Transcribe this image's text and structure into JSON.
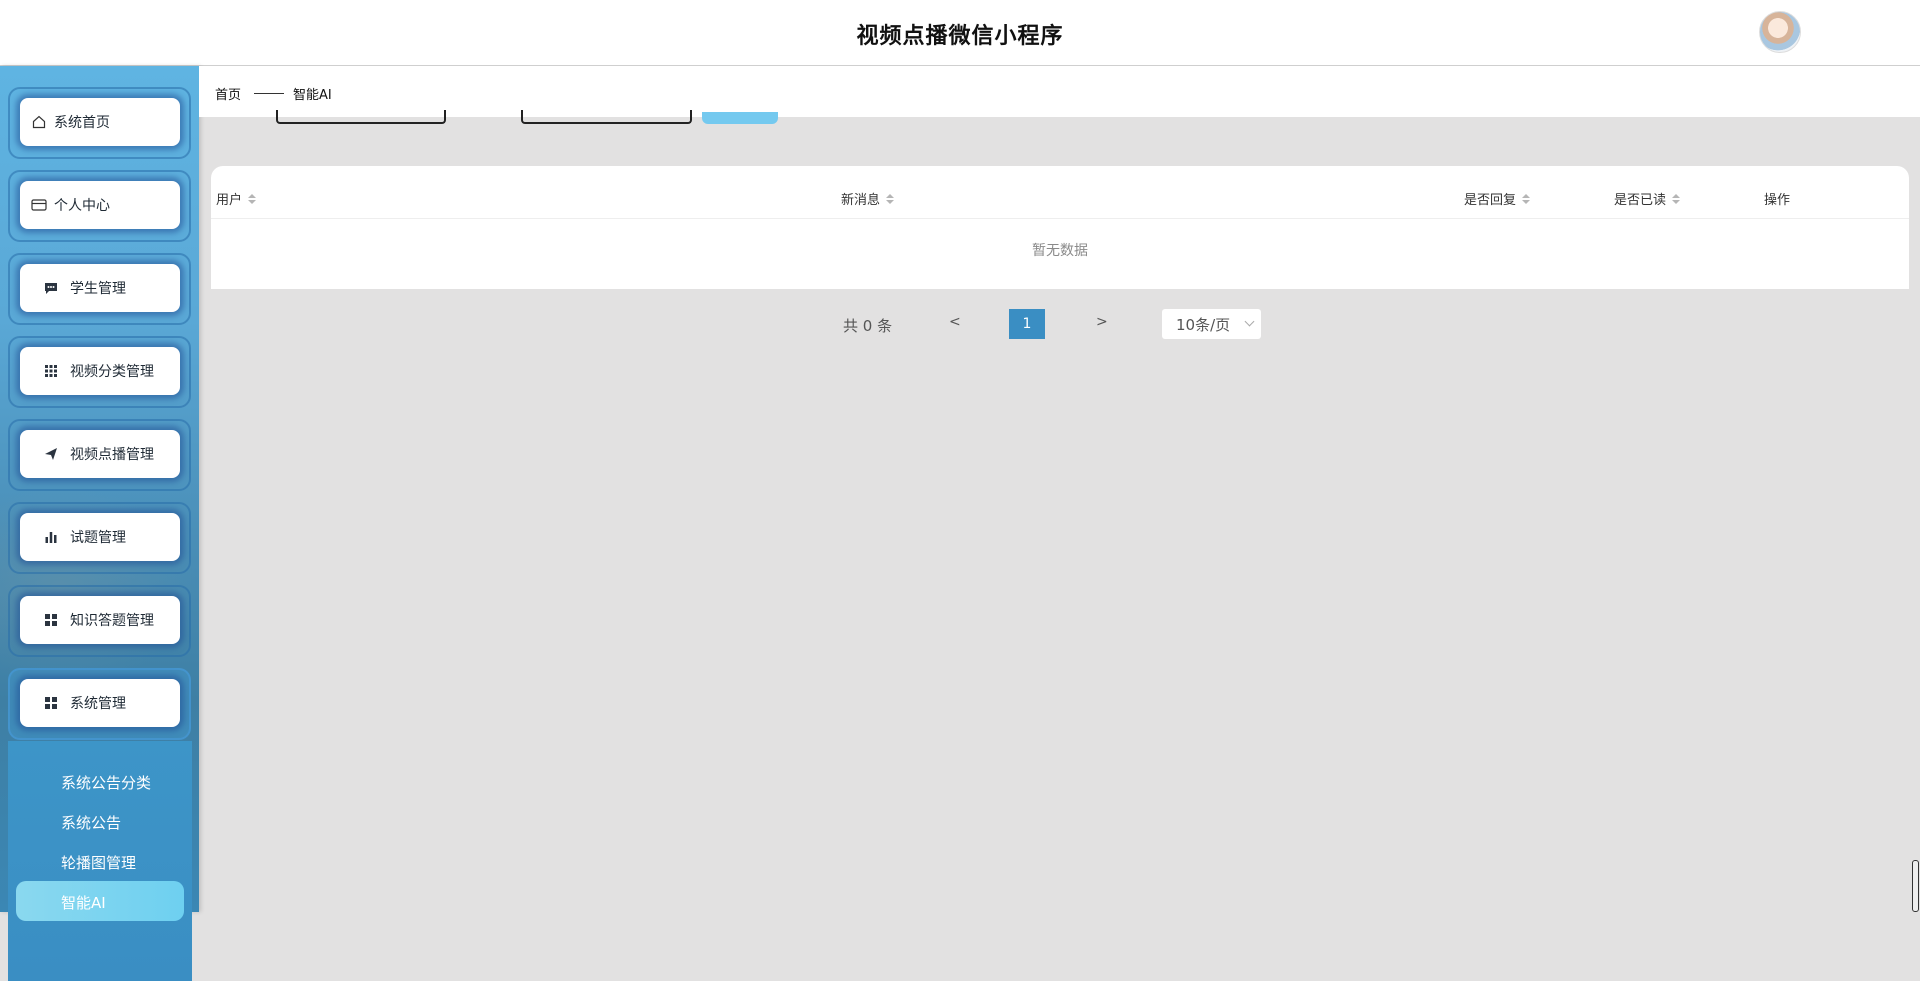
{
  "header": {
    "title": "视频点播微信小程序",
    "avatar_icon": "avatar"
  },
  "sidebar": {
    "items": [
      {
        "label": "系统首页",
        "icon": "home-icon"
      },
      {
        "label": "个人中心",
        "icon": "card-icon"
      },
      {
        "label": "学生管理",
        "icon": "chat-icon"
      },
      {
        "label": "视频分类管理",
        "icon": "grid-icon"
      },
      {
        "label": "视频点播管理",
        "icon": "send-icon"
      },
      {
        "label": "试题管理",
        "icon": "bar-chart-icon"
      },
      {
        "label": "知识答题管理",
        "icon": "apps-icon"
      },
      {
        "label": "系统管理",
        "icon": "apps-icon"
      }
    ],
    "sub_items": [
      "系统公告分类",
      "系统公告",
      "轮播图管理",
      "智能AI"
    ],
    "active_sub": "智能AI"
  },
  "breadcrumb": {
    "home": "首页",
    "current": "智能AI"
  },
  "table": {
    "columns": [
      "用户",
      "新消息",
      "是否回复",
      "是否已读",
      "操作"
    ],
    "empty_text": "暂无数据"
  },
  "pagination": {
    "total": "共 0 条",
    "prev": "<",
    "current_page": "1",
    "next": ">",
    "page_size": "10条/页"
  },
  "colors": {
    "accent": "#3a8ec3",
    "sidebar": "#5aa8d6",
    "button": "#74c9ef"
  }
}
